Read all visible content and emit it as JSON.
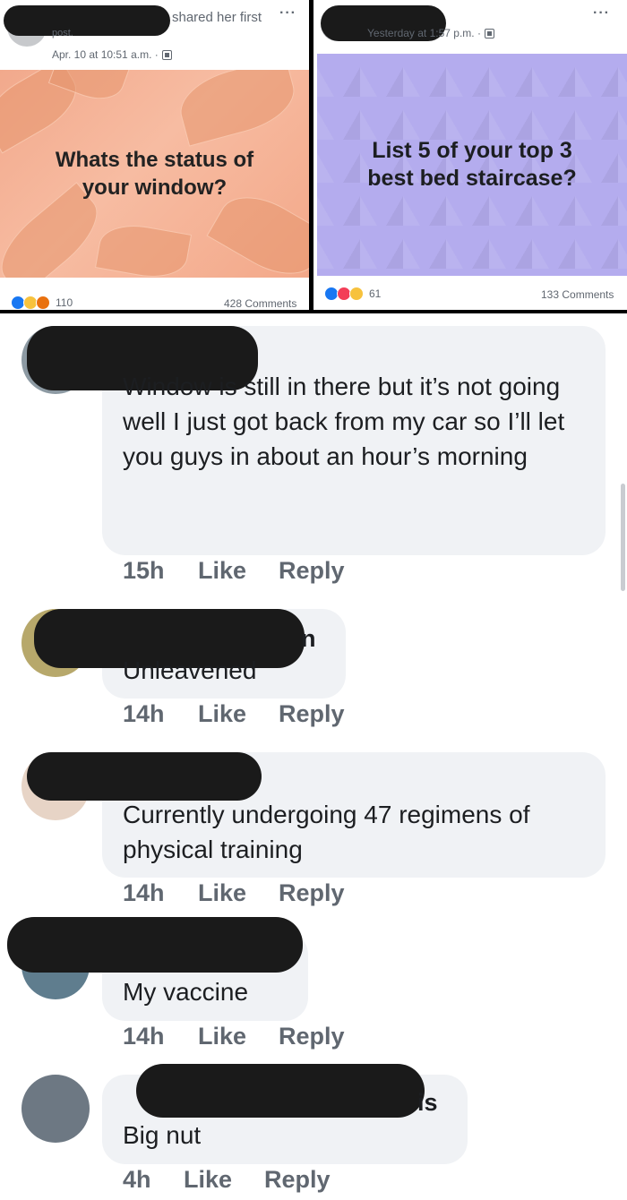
{
  "posts": [
    {
      "header_suffix": "shared her first",
      "header_cont": "post.",
      "timestamp": "Apr. 10 at 10:51 a.m. ·",
      "banner_text": "Whats the status of your window?",
      "reactions_count": "110",
      "comments": "428 Comments",
      "more_icon": "more-dots-icon"
    },
    {
      "timestamp": "Yesterday at 1:57 p.m. ·",
      "banner_text": "List 5 of your top 3 best bed staircase?",
      "reactions_count": "61",
      "comments": "133 Comments",
      "more_icon": "more-dots-icon"
    }
  ],
  "comments": [
    {
      "text": "Window is still in there but it’s not going well I just got back from my car so I’ll let you guys in about an hour’s morning",
      "time": "15h",
      "like": "Like",
      "reply": "Reply"
    },
    {
      "name_tail": "n",
      "text": "Unleavened",
      "time": "14h",
      "like": "Like",
      "reply": "Reply"
    },
    {
      "text": "Currently undergoing 47 regimens of physical training",
      "time": "14h",
      "like": "Like",
      "reply": "Reply"
    },
    {
      "text": "My vaccine",
      "time": "14h",
      "like": "Like",
      "reply": "Reply"
    },
    {
      "name_tail": "is",
      "text": "Big nut",
      "time": "4h",
      "like": "Like",
      "reply": "Reply"
    }
  ],
  "colors": {
    "bubble": "#f0f2f5",
    "redaction": "#1a1a1a",
    "like_blue": "#1877f2",
    "left_banner": "#f4ae93",
    "right_banner": "#b4acee"
  }
}
